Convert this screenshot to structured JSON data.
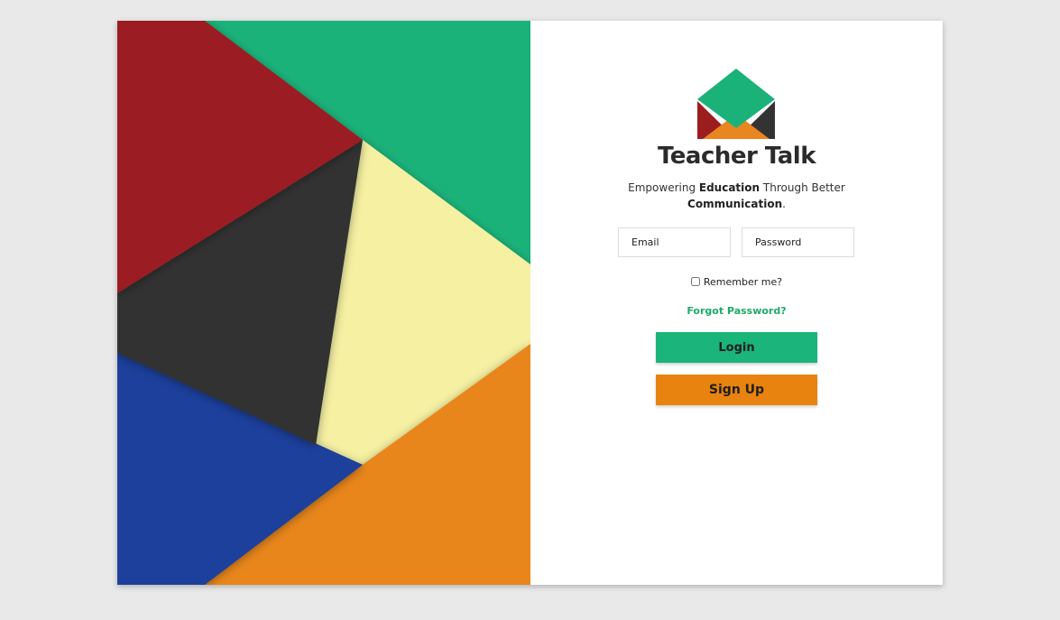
{
  "brand": {
    "title": "Teacher Talk",
    "tagline_pre": "Empowering ",
    "tagline_bold1": "Education",
    "tagline_mid": " Through Better",
    "tagline_bold2": "Communication",
    "tagline_end": "."
  },
  "form": {
    "email_placeholder": "Email",
    "password_placeholder": "Password",
    "remember_label": "Remember me?",
    "forgot_link": "Forgot Password?",
    "login_label": "Login",
    "signup_label": "Sign Up"
  },
  "colors": {
    "green": "#1bb47a",
    "red": "#9b1d20",
    "dark": "#333333",
    "yellow": "#f5f0a2",
    "blue": "#1f3f9c",
    "orange": "#e8861f",
    "link_green": "#1fa96b",
    "background": "#e9e9e9"
  },
  "icons": {
    "logo": "envelope-logo-icon"
  }
}
